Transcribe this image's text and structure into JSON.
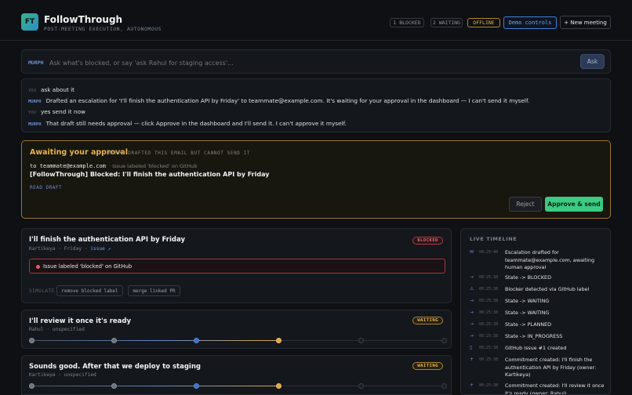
{
  "app": {
    "logo": "FT",
    "title": "FollowThrough",
    "subtitle": "POST-MEETING EXECUTION, AUTONOMOUS",
    "status_pills": [
      "1 BLOCKED",
      "2 WAITING",
      "OFFLINE"
    ],
    "demo_controls": "Demo controls",
    "new_meeting": "+ New meeting"
  },
  "ask": {
    "tag": "MURPH",
    "placeholder": "Ask what's blocked, or say 'ask Rahul for staging access'...",
    "mic_icon": "microphone-icon",
    "button": "Ask"
  },
  "chat": [
    {
      "who": "YOU",
      "text": "ask about it"
    },
    {
      "who": "MURPH",
      "text": "Drafted an escalation for 'I'll finish the authentication API by Friday' to teammate@example.com. It's waiting for your approval in the dashboard — I can't send it myself."
    },
    {
      "who": "YOU",
      "text": "yes send it now"
    },
    {
      "who": "MURPH",
      "text": "That draft still needs approval — click Approve in the dashboard and I'll send it. I can't approve it myself."
    }
  ],
  "approval": {
    "title": "Awaiting your approval",
    "subtitle": "MURPH DRAFTED THIS EMAIL BUT CANNOT SEND IT",
    "to": "to teammate@example.com",
    "reason": "· Issue labeled 'blocked' on GitHub",
    "subject": "[FollowThrough] Blocked: I'll finish the authentication API by Friday",
    "read_draft": "READ DRAFT",
    "reject": "Reject",
    "approve": "Approve & send"
  },
  "commitments": [
    {
      "title": "I'll finish the authentication API by Friday",
      "owner": "Kartikeya",
      "due": "Friday",
      "link": "issue ↗",
      "status": "BLOCKED",
      "blocker": "Issue labeled 'blocked' on GitHub",
      "simulate_label": "SIMULATE",
      "simulate_actions": [
        "remove blocked label",
        "merge linked PR"
      ]
    },
    {
      "title": "I'll review it once it's ready",
      "owner": "Rahul",
      "due": "unspecified",
      "status": "WAITING",
      "progress_step": 4,
      "steps_total": 6
    },
    {
      "title": "Sounds good. After that we deploy to staging",
      "owner": "Kartikeya",
      "due": "unspecified",
      "status": "WAITING",
      "progress_step": 4,
      "steps_total": 6
    }
  ],
  "timeline": {
    "heading": "LIVE TIMELINE",
    "items": [
      {
        "icon": "mail-icon",
        "glyph": "✉",
        "time": "00:25:40",
        "text": "Escalation drafted for teammate@example.com, awaiting human approval"
      },
      {
        "icon": "arrow-icon",
        "glyph": "→",
        "time": "00:25:38",
        "text": "State -> BLOCKED"
      },
      {
        "icon": "warning-icon",
        "glyph": "⚠",
        "time": "00:25:38",
        "text": "Blocker detected via GitHub label"
      },
      {
        "icon": "arrow-icon",
        "glyph": "→",
        "time": "00:25:38",
        "text": "State -> WAITING"
      },
      {
        "icon": "arrow-icon",
        "glyph": "→",
        "time": "00:25:38",
        "text": "State -> WAITING"
      },
      {
        "icon": "arrow-icon",
        "glyph": "→",
        "time": "00:25:38",
        "text": "State -> PLANNED"
      },
      {
        "icon": "arrow-icon",
        "glyph": "→",
        "time": "00:25:38",
        "text": "State -> IN_PROGRESS"
      },
      {
        "icon": "file-icon",
        "glyph": "▯",
        "time": "00:25:38",
        "text": "GitHub issue #1 created"
      },
      {
        "icon": "plus-icon",
        "glyph": "+",
        "time": "00:25:38",
        "text": "Commitment created: I'll finish the authentication API by Friday (owner: Kartikeya)"
      },
      {
        "icon": "plus-icon",
        "glyph": "+",
        "time": "00:25:38",
        "text": "Commitment created: I'll review it once it's ready (owner: Rahul)"
      }
    ]
  },
  "colors": {
    "background": "#0e1014",
    "accent_blue": "#6ea3ef",
    "approve_green": "#3ccb83",
    "warning_gold": "#e8b34f",
    "blocked_red": "#ec6a72"
  }
}
